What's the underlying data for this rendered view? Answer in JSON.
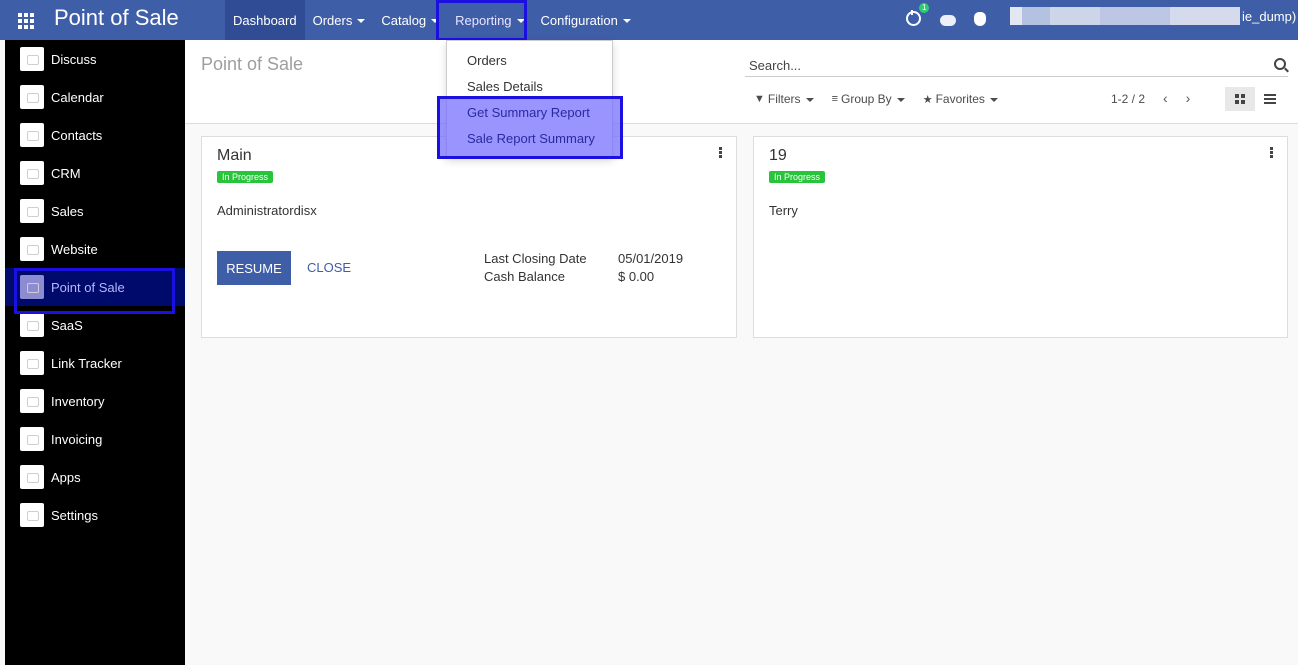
{
  "app_title": "Point of Sale",
  "topnav": [
    {
      "label": "Dashboard",
      "caret": false,
      "state": "active"
    },
    {
      "label": "Orders",
      "caret": true,
      "state": ""
    },
    {
      "label": "Catalog",
      "caret": true,
      "state": ""
    },
    {
      "label": "Reporting",
      "caret": true,
      "state": "open"
    },
    {
      "label": "Configuration",
      "caret": true,
      "state": ""
    }
  ],
  "systray": {
    "activity_count": "1",
    "user_suffix": "ie_dump)"
  },
  "sidebar": [
    "Discuss",
    "Calendar",
    "Contacts",
    "CRM",
    "Sales",
    "Website",
    "Point of Sale",
    "SaaS",
    "Link Tracker",
    "Inventory",
    "Invoicing",
    "Apps",
    "Settings"
  ],
  "sidebar_active": "Point of Sale",
  "control_panel": {
    "title": "Point of Sale",
    "search_placeholder": "Search...",
    "filters_label": "Filters",
    "groupby_label": "Group By",
    "favorites_label": "Favorites",
    "pager": "1-2 / 2"
  },
  "reporting_menu": [
    "Orders",
    "Sales Details",
    "Get Summary Report",
    "Sale Report Summary"
  ],
  "cards": [
    {
      "name": "Main",
      "status": "In Progress",
      "user": "Administratordisx",
      "resume_label": "RESUME",
      "close_label": "CLOSE",
      "last_closing_label": "Last Closing Date",
      "last_closing_value": "05/01/2019",
      "cash_balance_label": "Cash Balance",
      "cash_balance_value": "$ 0.00"
    },
    {
      "name": "19",
      "status": "In Progress",
      "user": "Terry"
    }
  ],
  "colors": {
    "navbar": "#3f5ea8",
    "sidebar": "#000000",
    "highlight": "#1b10e0",
    "badge": "#28c43b"
  }
}
